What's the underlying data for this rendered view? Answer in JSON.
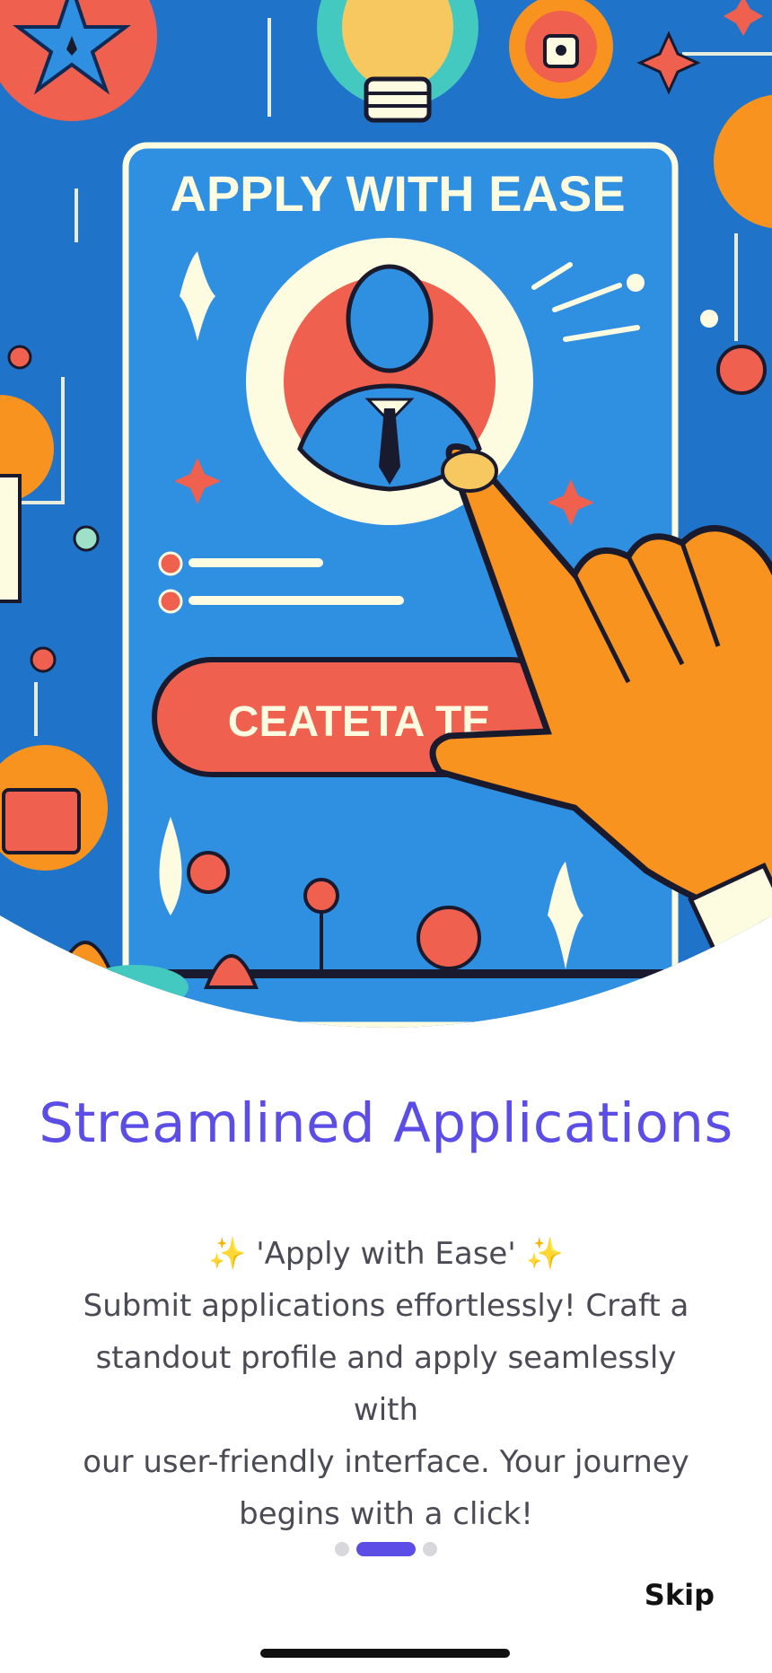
{
  "hero": {
    "card_heading": "APPLY WITH EASE",
    "card_button": "CEATETA TE"
  },
  "title": "Streamlined Applications",
  "description": {
    "tagline": "✨ 'Apply with Ease' ✨",
    "lines": [
      "Submit applications effortlessly! Craft a",
      "standout profile and apply seamlessly with",
      "our user-friendly interface. Your journey",
      "begins with a click!"
    ]
  },
  "pagination": {
    "total": 3,
    "active_index": 1
  },
  "skip_label": "Skip",
  "colors": {
    "accent": "#5b4de6",
    "hero_blue": "#1f74c9",
    "coral": "#f0604e",
    "orange": "#f7931e",
    "cream": "#fdfbe0"
  }
}
